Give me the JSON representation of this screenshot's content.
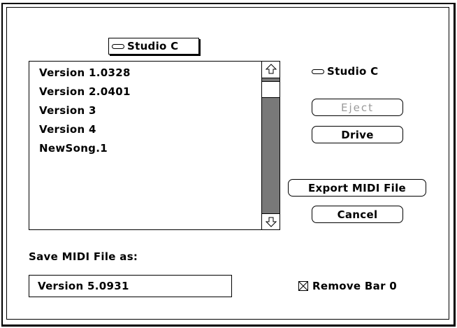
{
  "volume_popup": {
    "label": "Studio C",
    "icon": "disk-icon"
  },
  "file_list": {
    "items": [
      "Version 1.0328",
      "Version 2.0401",
      "Version 3",
      "Version 4",
      "NewSong.1"
    ]
  },
  "volume_label": "Studio C",
  "buttons": {
    "eject": "Eject",
    "drive": "Drive",
    "export": "Export MIDI File",
    "cancel": "Cancel"
  },
  "save_as_label": "Save MIDI File as:",
  "filename_value": "Version 5.0931",
  "remove_bar_zero": {
    "label": "Remove Bar 0",
    "checked": true
  }
}
